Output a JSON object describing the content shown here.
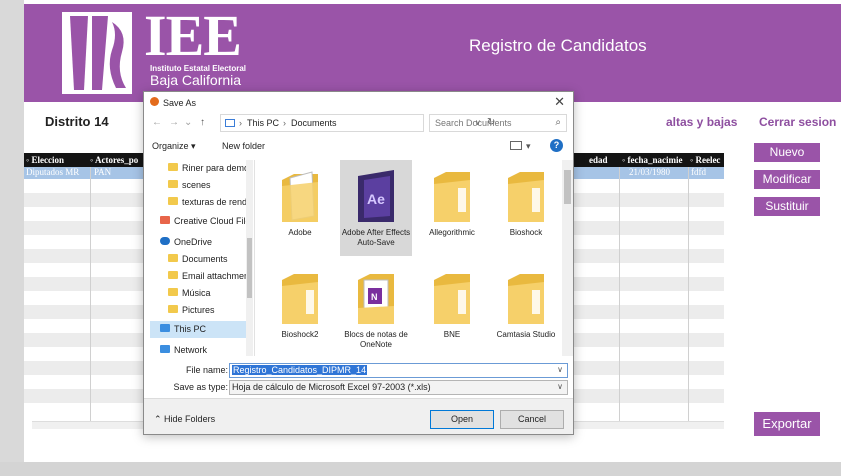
{
  "header": {
    "logo_text": "IEE",
    "logo_subtitle_1": "Instituto Estatal Electoral",
    "logo_subtitle_2": "Baja California",
    "app_title": "Registro de Candidatos"
  },
  "nav": {
    "district": "Distrito 14",
    "links": [
      "altas y bajas",
      "Cerrar sesion"
    ]
  },
  "grid": {
    "columns": [
      "Eleccion",
      "Actores_po",
      "edad",
      "fecha_nacimie",
      "Reelec"
    ],
    "selected_row": [
      "Diputados MR",
      "PAN",
      "21/03/1980",
      "fdfd"
    ]
  },
  "side_buttons": [
    "Nuevo",
    "Modificar",
    "Sustituir"
  ],
  "export_label": "Exportar",
  "dialog": {
    "title": "Save As",
    "close_glyph": "✕",
    "breadcrumb": [
      "This PC",
      "Documents"
    ],
    "search_placeholder": "Search Documents",
    "organize_label": "Organize ▾",
    "new_folder_label": "New folder",
    "help_glyph": "?",
    "nav_items": [
      {
        "label": "Riner para demo I ^",
        "icon": "folder-icon"
      },
      {
        "label": "scenes",
        "icon": "folder-icon"
      },
      {
        "label": "texturas de rende",
        "icon": "folder-icon"
      },
      {
        "label": "Creative Cloud File",
        "icon": "creative-cloud-icon"
      },
      {
        "label": "OneDrive",
        "icon": "onedrive-icon"
      },
      {
        "label": "Documents",
        "icon": "folder-icon"
      },
      {
        "label": "Email attachmen",
        "icon": "folder-icon"
      },
      {
        "label": "Música",
        "icon": "folder-icon"
      },
      {
        "label": "Pictures",
        "icon": "folder-icon"
      },
      {
        "label": "This PC",
        "icon": "pc-icon"
      },
      {
        "label": "Network",
        "icon": "network-icon"
      }
    ],
    "files": [
      {
        "name": "Adobe",
        "kind": "folder-doc"
      },
      {
        "name": "Adobe After Effects Auto-Save",
        "kind": "ae"
      },
      {
        "name": "Allegorithmic",
        "kind": "folder"
      },
      {
        "name": "Bioshock",
        "kind": "folder"
      },
      {
        "name": "Bioshock2",
        "kind": "folder"
      },
      {
        "name": "Blocs de notas de OneNote",
        "kind": "onenote"
      },
      {
        "name": "BNE",
        "kind": "folder"
      },
      {
        "name": "Camtasia Studio",
        "kind": "folder"
      }
    ],
    "file_name_label": "File name:",
    "file_name_value": "Registro_Candidatos_DIPMR_14",
    "save_type_label": "Save as type:",
    "save_type_value": "Hoja de cálculo de Microsoft Excel 97-2003 (*.xls)",
    "hide_folders_label": "Hide Folders",
    "open_label": "Open",
    "cancel_label": "Cancel"
  },
  "colors": {
    "brand_purple": "#9a54a8",
    "selection_blue": "#a6c4e6",
    "folder_yellow": "#f2c94c"
  }
}
